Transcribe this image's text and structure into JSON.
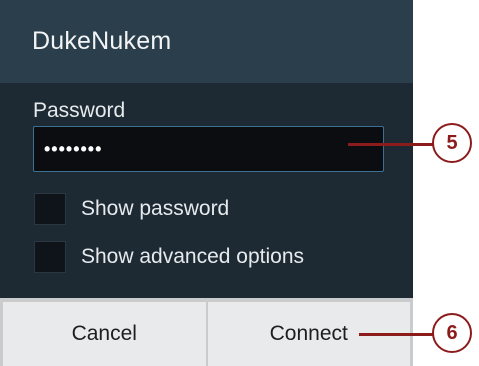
{
  "dialog": {
    "title": "DukeNukem",
    "password_label": "Password",
    "password_value": "••••••••",
    "show_password_label": "Show password",
    "show_advanced_label": "Show advanced options",
    "show_password_checked": false,
    "show_advanced_checked": false
  },
  "buttons": {
    "cancel_label": "Cancel",
    "connect_label": "Connect"
  },
  "callouts": {
    "password_callout": "5",
    "connect_callout": "6"
  },
  "colors": {
    "dialog_background": "#1d2a33",
    "title_bar": "#2a3e4c",
    "input_border": "#3d6f90",
    "callout": "#8c1c1c"
  }
}
